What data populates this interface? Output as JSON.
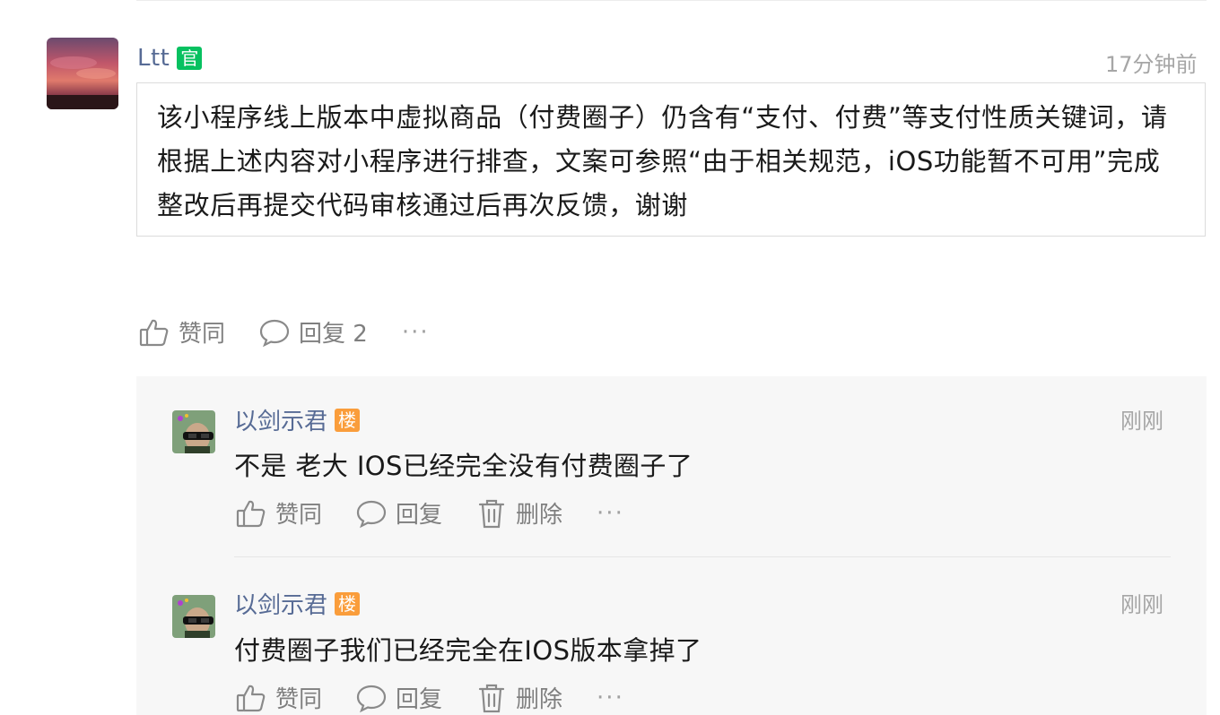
{
  "post": {
    "author": "Ltt",
    "author_badge": "官",
    "time": "17分钟前",
    "content": "该小程序线上版本中虚拟商品（付费圈子）仍含有“支付、付费”等支付性质关键词，请根据上述内容对小程序进行排查，文案可参照“由于相关规范，iOS功能暂不可用”完成整改后再提交代码审核通过后再次反馈，谢谢",
    "like_label": "赞同",
    "reply_label": "回复 2",
    "more_label": "···"
  },
  "replies": [
    {
      "author": "以剑示君",
      "badge": "楼",
      "time": "刚刚",
      "text": "不是 老大 IOS已经完全没有付费圈子了",
      "like_label": "赞同",
      "reply_label": "回复",
      "delete_label": "删除",
      "more_label": "···"
    },
    {
      "author": "以剑示君",
      "badge": "楼",
      "time": "刚刚",
      "text": "付费圈子我们已经完全在IOS版本拿掉了",
      "like_label": "赞同",
      "reply_label": "回复",
      "delete_label": "删除",
      "more_label": "···"
    }
  ],
  "icons": {
    "like": "thumbs-up-icon",
    "reply": "speech-bubble-icon",
    "delete": "trash-icon",
    "more": "ellipsis-icon"
  },
  "colors": {
    "name_link": "#576b95",
    "official_badge": "#07c160",
    "floor_badge": "#fa9d3b",
    "muted": "#7f7f7f"
  }
}
